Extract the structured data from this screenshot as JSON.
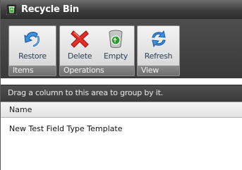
{
  "window": {
    "title": "Recycle Bin",
    "icon": "recycle-bin-icon"
  },
  "ribbon": {
    "groups": [
      {
        "caption": "Items",
        "buttons": [
          {
            "label": "Restore",
            "icon": "restore-arrow-icon"
          }
        ]
      },
      {
        "caption": "Operations",
        "buttons": [
          {
            "label": "Delete",
            "icon": "delete-x-icon"
          },
          {
            "label": "Empty",
            "icon": "empty-bin-icon"
          }
        ]
      },
      {
        "caption": "View",
        "buttons": [
          {
            "label": "Refresh",
            "icon": "refresh-icon"
          }
        ]
      }
    ]
  },
  "grid": {
    "group_by_hint": "Drag a column to this area to group by it.",
    "columns": [
      "Name"
    ],
    "rows": [
      {
        "name": "New Test Field Type Template"
      }
    ]
  },
  "colors": {
    "ribbon_bg": "#3a3a3a",
    "group_bg": "#e6e6e6",
    "caption_bg": "#7a7a7a",
    "label_text": "#2c3f55",
    "delete_red": "#e0302a",
    "bin_green": "#2f9a2f",
    "arrow_blue": "#2d7fd6"
  }
}
